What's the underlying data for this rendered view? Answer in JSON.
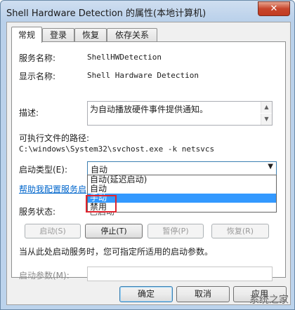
{
  "window": {
    "title": "Shell Hardware Detection 的属性(本地计算机)",
    "close_label": "✕"
  },
  "tabs": [
    {
      "label": "常规"
    },
    {
      "label": "登录"
    },
    {
      "label": "恢复"
    },
    {
      "label": "依存关系"
    }
  ],
  "general": {
    "service_name_label": "服务名称:",
    "service_name_value": "ShellHWDetection",
    "display_name_label": "显示名称:",
    "display_name_value": "Shell Hardware Detection",
    "description_label": "描述:",
    "description_value": "为自动播放硬件事件提供通知。",
    "exe_path_label": "可执行文件的路径:",
    "exe_path_value": "C:\\windows\\System32\\svchost.exe -k netsvcs",
    "startup_type_label": "启动类型(E):",
    "startup_type_value": "自动",
    "startup_options": [
      "自动(延迟启动)",
      "自动",
      "手动",
      "禁用"
    ],
    "help_link": "帮助我配置服务启",
    "service_status_label": "服务状态:",
    "service_status_value": "已启动",
    "buttons": {
      "start": "启动(S)",
      "stop": "停止(T)",
      "pause": "暂停(P)",
      "resume": "恢复(R)"
    },
    "hint": "当从此处启动服务时，您可指定所适用的启动参数。",
    "start_params_label": "启动参数(M):",
    "start_params_value": ""
  },
  "footer": {
    "ok": "确定",
    "cancel": "取消",
    "apply": "应用"
  },
  "watermark": "系统之家",
  "colors": {
    "accent": "#3399ff",
    "link": "#0066cc",
    "highlight_box": "#e0232e"
  }
}
